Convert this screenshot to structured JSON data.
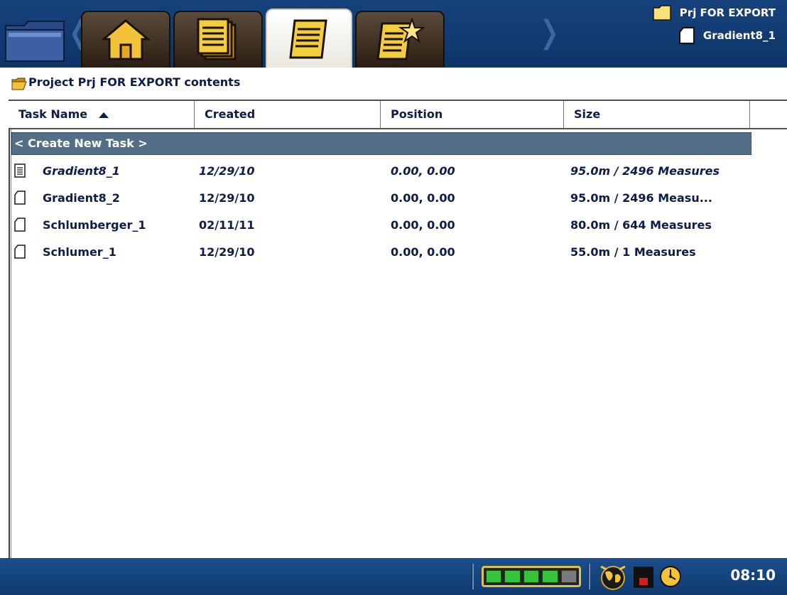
{
  "header": {
    "project_name": "Prj FOR EXPORT",
    "task_name": "Gradient8_1",
    "tabs": [
      {
        "icon": "folder-icon"
      },
      {
        "icon": "home-icon"
      },
      {
        "icon": "stacked-documents-icon"
      },
      {
        "icon": "document-icon"
      },
      {
        "icon": "document-star-icon"
      }
    ]
  },
  "subheader": {
    "title": "Project Prj FOR EXPORT contents",
    "icon": "open-folder-icon"
  },
  "table": {
    "columns": [
      "Task Name",
      "Created",
      "Position",
      "Size"
    ],
    "sort_column": "Task Name",
    "sort_direction": "ascending",
    "create_label": "< Create New Task >",
    "rows": [
      {
        "name": "Gradient8_1",
        "created": "12/29/10",
        "position": "0.00, 0.00",
        "size": "95.0m / 2496 Measures",
        "icon": "document-lines-icon",
        "current": true
      },
      {
        "name": "Gradient8_2",
        "created": "12/29/10",
        "position": "0.00, 0.00",
        "size": "95.0m / 2496 Measu...",
        "icon": "document-icon",
        "current": false
      },
      {
        "name": "Schlumberger_1",
        "created": "02/11/11",
        "position": "0.00, 0.00",
        "size": "80.0m / 644 Measures",
        "icon": "document-icon",
        "current": false
      },
      {
        "name": "Schlumer_1",
        "created": "12/29/10",
        "position": "0.00, 0.00",
        "size": "55.0m / 1 Measures",
        "icon": "document-icon",
        "current": false
      }
    ]
  },
  "status": {
    "battery_level": 0.8,
    "time": "08:10",
    "colors": {
      "bar": "#0f3a70",
      "battery_on": "#36c43a",
      "record": "#d22020"
    }
  }
}
